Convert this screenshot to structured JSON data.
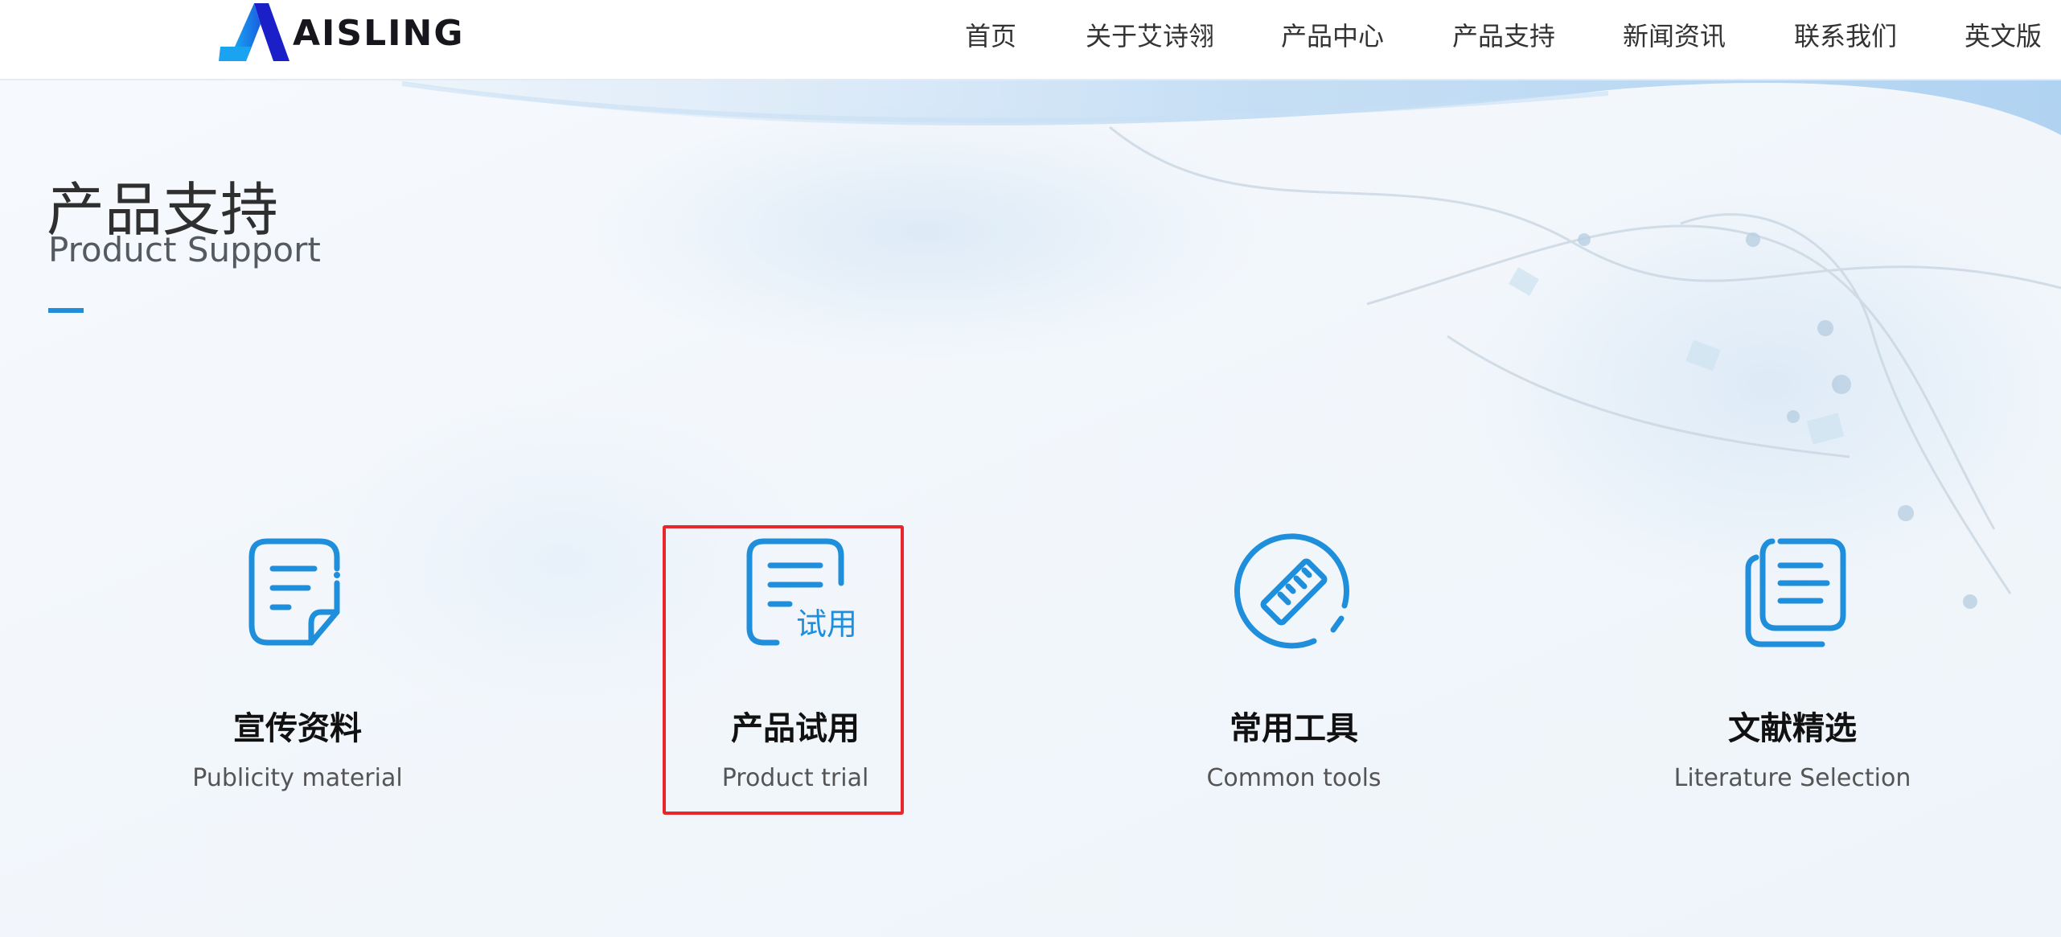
{
  "brand": {
    "logo_text": "AISLING"
  },
  "nav": {
    "items": [
      {
        "label": "首页"
      },
      {
        "label": "关于艾诗翎"
      },
      {
        "label": "产品中心"
      },
      {
        "label": "产品支持"
      },
      {
        "label": "新闻资讯"
      },
      {
        "label": "联系我们"
      },
      {
        "label": "英文版"
      }
    ]
  },
  "hero": {
    "title": "产品支持",
    "subtitle": "Product Support"
  },
  "cards": [
    {
      "title": "宣传资料",
      "subtitle": "Publicity material",
      "icon": "document-icon"
    },
    {
      "title": "产品试用",
      "subtitle": "Product trial",
      "icon": "trial-document-icon",
      "icon_text": "试用",
      "selected": true
    },
    {
      "title": "常用工具",
      "subtitle": "Common tools",
      "icon": "ruler-icon"
    },
    {
      "title": "文献精选",
      "subtitle": "Literature Selection",
      "icon": "documents-stack-icon"
    }
  ],
  "colors": {
    "accent": "#1f8fdc",
    "highlight": "#e8262b",
    "logo_dark": "#1a1fc8",
    "logo_light": "#1aa3f0"
  }
}
